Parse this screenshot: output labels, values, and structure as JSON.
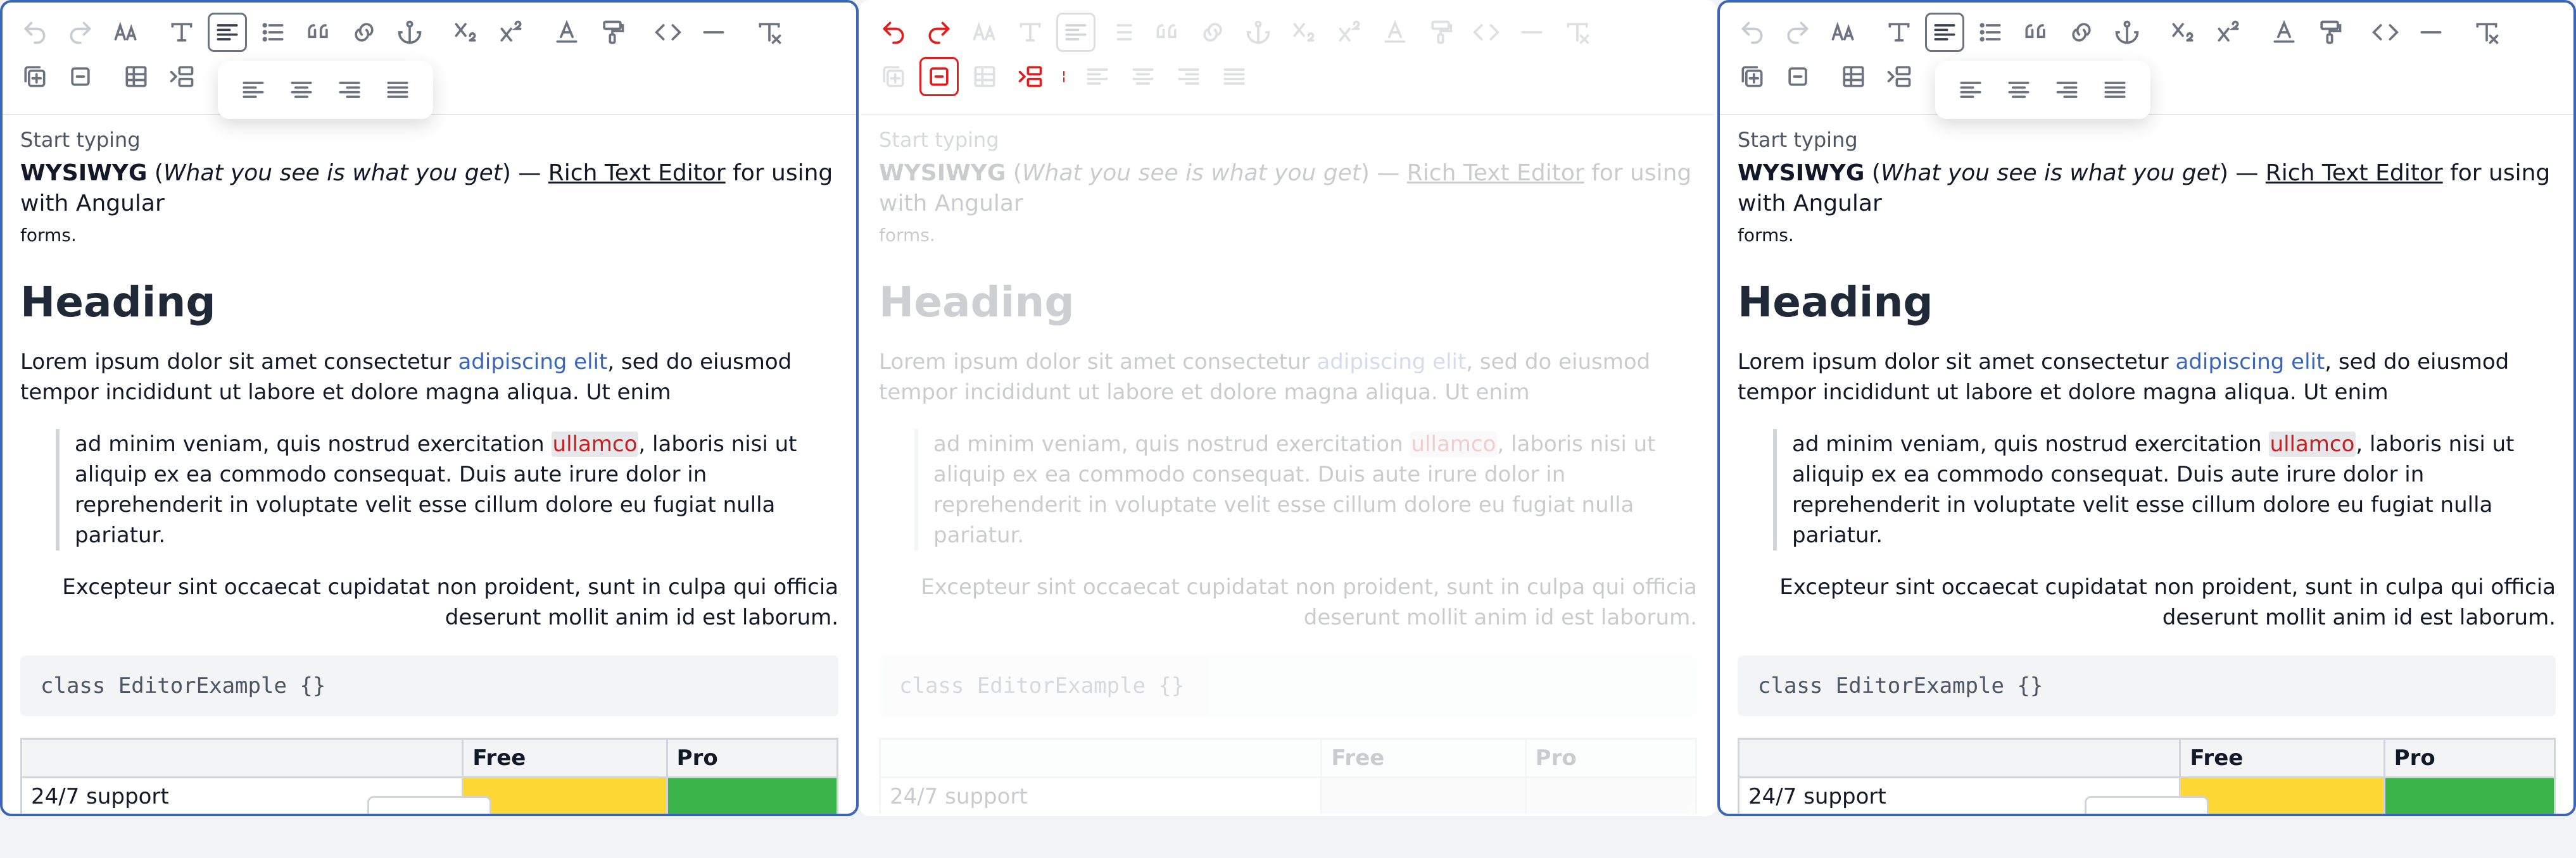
{
  "colors": {
    "accent": "#3b66b8",
    "link": "#3b66b8",
    "highlight_text": "#c81e1e",
    "cell_yellow": "#fdd835",
    "cell_green": "#3bb54a",
    "danger": "#e11d1d"
  },
  "editor": {
    "placeholder": "Start typing",
    "intro": {
      "brand": "WYSIWYG",
      "open": "(",
      "italic": "What you see is what you get",
      "close": ")",
      "dash": " — ",
      "link_text": "Rich Text Editor",
      "tail": " for using with Angular",
      "tail2": "forms."
    },
    "heading": "Heading",
    "para1_a": "Lorem ipsum dolor sit amet consectetur ",
    "para1_link": "adipiscing elit",
    "para1_b": ", sed do eiusmod tempor incididunt ut labore et dolore magna aliqua. Ut enim",
    "quote_a": "ad minim veniam, quis nostrud exercitation ",
    "quote_hl": "ullamco",
    "quote_b": ", laboris nisi ut aliquip ex ea commodo consequat. Duis aute irure dolor in reprehenderit in voluptate velit esse cillum dolore eu fugiat nulla pariatur.",
    "right_para": "Excepteur sint occaecat cupidatat non proident, sunt in culpa qui officia deserunt mollit anim id est laborum.",
    "code": "class EditorExample {}",
    "table": {
      "headers": [
        "",
        "Free",
        "Pro"
      ],
      "rows": [
        [
          "24/7 support",
          "",
          ""
        ]
      ]
    }
  },
  "toolbar": {
    "icons_row1": [
      "undo-icon",
      "redo-icon",
      "font-size-icon",
      "text-style-icon",
      "align-icon",
      "list-icon",
      "quote-icon",
      "link-icon",
      "anchor-icon",
      "subscript-icon",
      "superscript-icon",
      "text-color-icon",
      "paint-icon",
      "code-icon",
      "horizontal-rule-icon",
      "clear-format-icon"
    ],
    "icons_row2": [
      "insert-cell-icon",
      "remove-cell-icon",
      "table-icon",
      "insert-row-icon"
    ],
    "align_popover": [
      "align-left-icon",
      "align-center-icon",
      "align-right-icon",
      "align-justify-icon"
    ]
  }
}
